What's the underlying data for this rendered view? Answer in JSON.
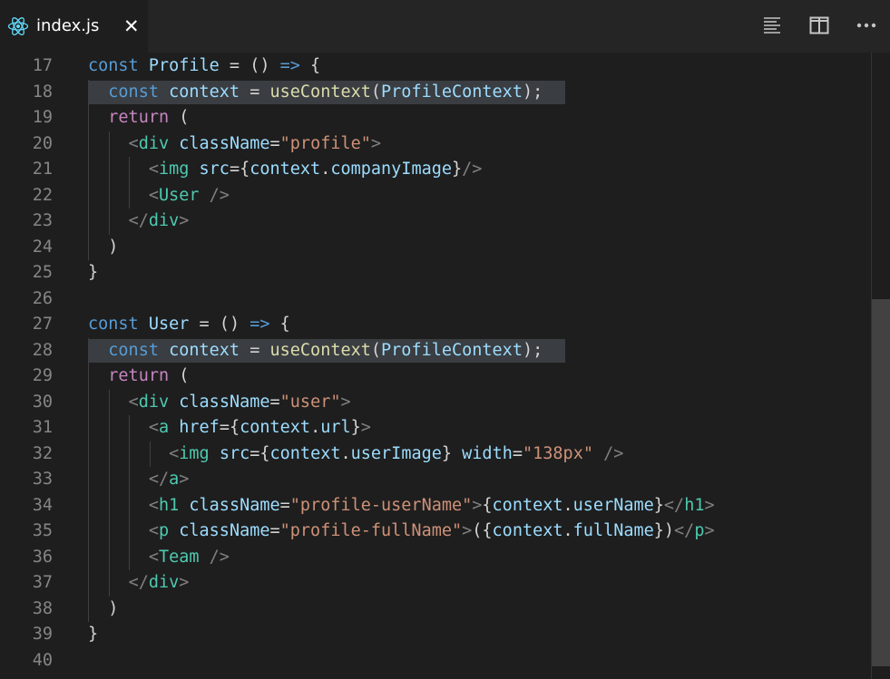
{
  "tab": {
    "title": "index.js",
    "icon": "react-icon",
    "close": "✕"
  },
  "toolbar": {
    "actions": [
      {
        "name": "toggle-minimap-icon"
      },
      {
        "name": "split-editor-icon"
      },
      {
        "name": "more-actions-icon"
      }
    ]
  },
  "colors": {
    "background": "#1e1e1e",
    "tabbar": "#252526",
    "line_number": "#858585",
    "selection_highlight": "#3a3d41",
    "keyword": "#569cd6",
    "control": "#c586c0",
    "variable": "#9cdcfe",
    "function": "#dcdcaa",
    "tag": "#4ec9b0",
    "bracket": "#808080",
    "string": "#ce9178"
  },
  "editor": {
    "lines": [
      {
        "n": "17",
        "hl": false,
        "tokens": [
          [
            "kw",
            "const "
          ],
          [
            "var",
            "Profile"
          ],
          [
            "op",
            " = () "
          ],
          [
            "kw",
            "=>"
          ],
          [
            "op",
            " {"
          ]
        ]
      },
      {
        "n": "18",
        "hl": true,
        "tokens": [
          [
            "op",
            "  "
          ],
          [
            "kw",
            "const "
          ],
          [
            "var",
            "context"
          ],
          [
            "op",
            " = "
          ],
          [
            "fn",
            "useContext"
          ],
          [
            "op",
            "("
          ],
          [
            "var",
            "ProfileContext"
          ],
          [
            "op",
            ");"
          ]
        ]
      },
      {
        "n": "19",
        "hl": false,
        "tokens": [
          [
            "op",
            "  "
          ],
          [
            "ctl",
            "return"
          ],
          [
            "op",
            " ("
          ]
        ]
      },
      {
        "n": "20",
        "hl": false,
        "tokens": [
          [
            "op",
            "    "
          ],
          [
            "br",
            "<"
          ],
          [
            "tag",
            "div"
          ],
          [
            "op",
            " "
          ],
          [
            "var",
            "className"
          ],
          [
            "op",
            "="
          ],
          [
            "str",
            "\"profile\""
          ],
          [
            "br",
            ">"
          ]
        ]
      },
      {
        "n": "21",
        "hl": false,
        "tokens": [
          [
            "op",
            "      "
          ],
          [
            "br",
            "<"
          ],
          [
            "tag",
            "img"
          ],
          [
            "op",
            " "
          ],
          [
            "var",
            "src"
          ],
          [
            "op",
            "={"
          ],
          [
            "var",
            "context"
          ],
          [
            "op",
            "."
          ],
          [
            "var",
            "companyImage"
          ],
          [
            "op",
            "}"
          ],
          [
            "br",
            "/>"
          ]
        ]
      },
      {
        "n": "22",
        "hl": false,
        "tokens": [
          [
            "op",
            "      "
          ],
          [
            "br",
            "<"
          ],
          [
            "tag",
            "User"
          ],
          [
            "op",
            " "
          ],
          [
            "br",
            "/>"
          ]
        ]
      },
      {
        "n": "23",
        "hl": false,
        "tokens": [
          [
            "op",
            "    "
          ],
          [
            "br",
            "</"
          ],
          [
            "tag",
            "div"
          ],
          [
            "br",
            ">"
          ]
        ]
      },
      {
        "n": "24",
        "hl": false,
        "tokens": [
          [
            "op",
            "  )"
          ]
        ]
      },
      {
        "n": "25",
        "hl": false,
        "tokens": [
          [
            "op",
            "}"
          ]
        ]
      },
      {
        "n": "26",
        "hl": false,
        "tokens": []
      },
      {
        "n": "27",
        "hl": false,
        "tokens": [
          [
            "kw",
            "const "
          ],
          [
            "var",
            "User"
          ],
          [
            "op",
            " = () "
          ],
          [
            "kw",
            "=>"
          ],
          [
            "op",
            " {"
          ]
        ]
      },
      {
        "n": "28",
        "hl": true,
        "tokens": [
          [
            "op",
            "  "
          ],
          [
            "kw",
            "const "
          ],
          [
            "var",
            "context"
          ],
          [
            "op",
            " = "
          ],
          [
            "fn",
            "useContext"
          ],
          [
            "op",
            "("
          ],
          [
            "var",
            "ProfileContext"
          ],
          [
            "op",
            ");"
          ]
        ]
      },
      {
        "n": "29",
        "hl": false,
        "tokens": [
          [
            "op",
            "  "
          ],
          [
            "ctl",
            "return"
          ],
          [
            "op",
            " ("
          ]
        ]
      },
      {
        "n": "30",
        "hl": false,
        "tokens": [
          [
            "op",
            "    "
          ],
          [
            "br",
            "<"
          ],
          [
            "tag",
            "div"
          ],
          [
            "op",
            " "
          ],
          [
            "var",
            "className"
          ],
          [
            "op",
            "="
          ],
          [
            "str",
            "\"user\""
          ],
          [
            "br",
            ">"
          ]
        ]
      },
      {
        "n": "31",
        "hl": false,
        "tokens": [
          [
            "op",
            "      "
          ],
          [
            "br",
            "<"
          ],
          [
            "tag",
            "a"
          ],
          [
            "op",
            " "
          ],
          [
            "var",
            "href"
          ],
          [
            "op",
            "={"
          ],
          [
            "var",
            "context"
          ],
          [
            "op",
            "."
          ],
          [
            "var",
            "url"
          ],
          [
            "op",
            "}"
          ],
          [
            "br",
            ">"
          ]
        ]
      },
      {
        "n": "32",
        "hl": false,
        "tokens": [
          [
            "op",
            "        "
          ],
          [
            "br",
            "<"
          ],
          [
            "tag",
            "img"
          ],
          [
            "op",
            " "
          ],
          [
            "var",
            "src"
          ],
          [
            "op",
            "={"
          ],
          [
            "var",
            "context"
          ],
          [
            "op",
            "."
          ],
          [
            "var",
            "userImage"
          ],
          [
            "op",
            "} "
          ],
          [
            "var",
            "width"
          ],
          [
            "op",
            "="
          ],
          [
            "str",
            "\"138px\""
          ],
          [
            "op",
            " "
          ],
          [
            "br",
            "/>"
          ]
        ]
      },
      {
        "n": "33",
        "hl": false,
        "tokens": [
          [
            "op",
            "      "
          ],
          [
            "br",
            "</"
          ],
          [
            "tag",
            "a"
          ],
          [
            "br",
            ">"
          ]
        ]
      },
      {
        "n": "34",
        "hl": false,
        "tokens": [
          [
            "op",
            "      "
          ],
          [
            "br",
            "<"
          ],
          [
            "tag",
            "h1"
          ],
          [
            "op",
            " "
          ],
          [
            "var",
            "className"
          ],
          [
            "op",
            "="
          ],
          [
            "str",
            "\"profile-userName\""
          ],
          [
            "br",
            ">"
          ],
          [
            "op",
            "{"
          ],
          [
            "var",
            "context"
          ],
          [
            "op",
            "."
          ],
          [
            "var",
            "userName"
          ],
          [
            "op",
            "}"
          ],
          [
            "br",
            "</"
          ],
          [
            "tag",
            "h1"
          ],
          [
            "br",
            ">"
          ]
        ]
      },
      {
        "n": "35",
        "hl": false,
        "tokens": [
          [
            "op",
            "      "
          ],
          [
            "br",
            "<"
          ],
          [
            "tag",
            "p"
          ],
          [
            "op",
            " "
          ],
          [
            "var",
            "className"
          ],
          [
            "op",
            "="
          ],
          [
            "str",
            "\"profile-fullName\""
          ],
          [
            "br",
            ">"
          ],
          [
            "op",
            "({"
          ],
          [
            "var",
            "context"
          ],
          [
            "op",
            "."
          ],
          [
            "var",
            "fullName"
          ],
          [
            "op",
            "})"
          ],
          [
            "br",
            "</"
          ],
          [
            "tag",
            "p"
          ],
          [
            "br",
            ">"
          ]
        ]
      },
      {
        "n": "36",
        "hl": false,
        "tokens": [
          [
            "op",
            "      "
          ],
          [
            "br",
            "<"
          ],
          [
            "tag",
            "Team"
          ],
          [
            "op",
            " "
          ],
          [
            "br",
            "/>"
          ]
        ]
      },
      {
        "n": "37",
        "hl": false,
        "tokens": [
          [
            "op",
            "    "
          ],
          [
            "br",
            "</"
          ],
          [
            "tag",
            "div"
          ],
          [
            "br",
            ">"
          ]
        ]
      },
      {
        "n": "38",
        "hl": false,
        "tokens": [
          [
            "op",
            "  )"
          ]
        ]
      },
      {
        "n": "39",
        "hl": false,
        "tokens": [
          [
            "op",
            "}"
          ]
        ]
      },
      {
        "n": "40",
        "hl": false,
        "tokens": []
      }
    ]
  }
}
